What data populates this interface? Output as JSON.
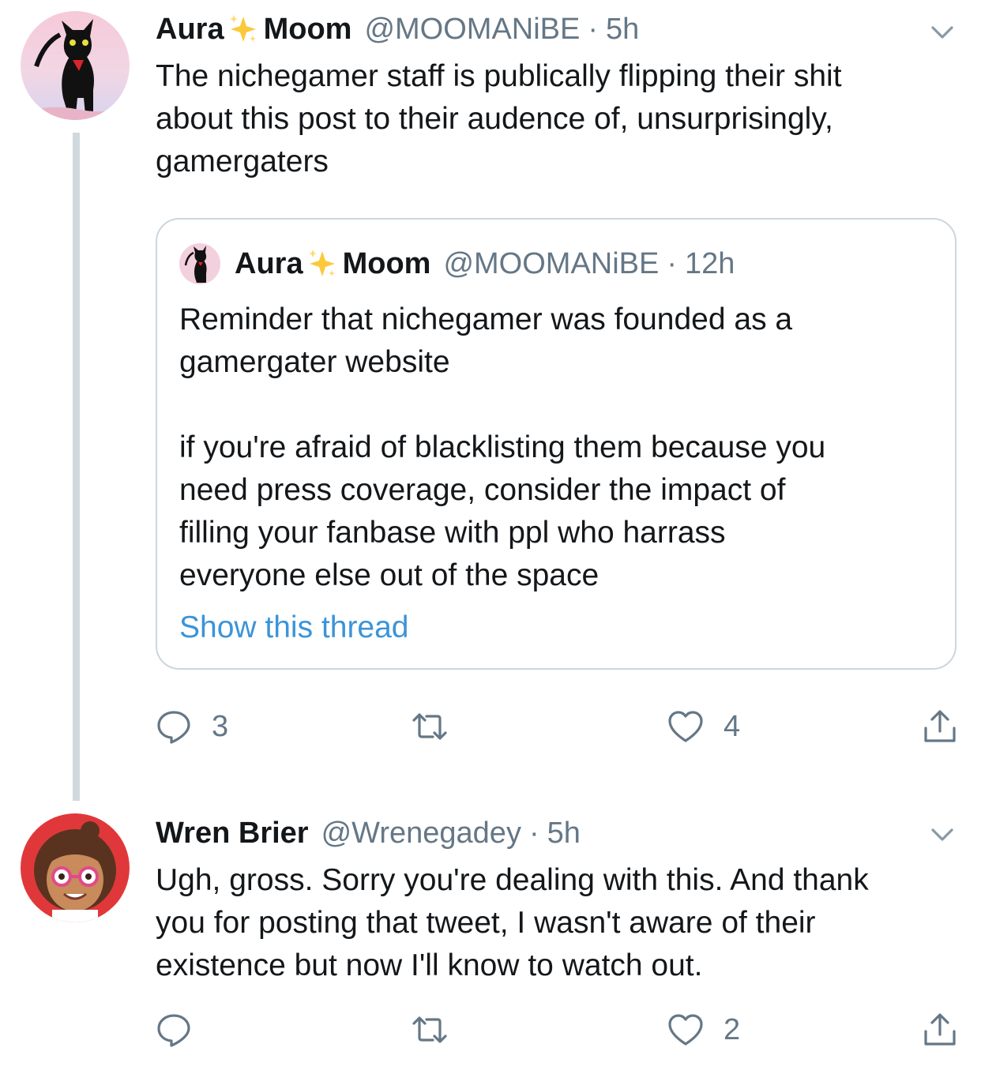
{
  "tweets": [
    {
      "author_name_part1": "Aura",
      "author_name_part2": "Moom",
      "sparkle_icon": "sparkles-emoji",
      "handle": "@MOOMANiBE",
      "separator": "·",
      "time": "5h",
      "text_lines": [
        "The nichegamer staff is publically flipping their shit",
        "about this post to their audence of, unsurprisingly,",
        "gamergaters"
      ],
      "quote": {
        "author_name_part1": "Aura",
        "author_name_part2": "Moom",
        "handle": "@MOOMANiBE",
        "separator": "·",
        "time": "12h",
        "paragraph1_lines": [
          "Reminder that nichegamer was founded as a",
          "gamergater website"
        ],
        "paragraph2_lines": [
          "if you're afraid of blacklisting them because you",
          "need press coverage, consider the impact of",
          "filling your fanbase with ppl who harrass",
          "everyone else out of the space"
        ],
        "show_thread": "Show this thread"
      },
      "actions": {
        "replies": "3",
        "retweets": "",
        "likes": "4"
      }
    },
    {
      "author_name": "Wren Brier",
      "handle": "@Wrenegadey",
      "separator": "·",
      "time": "5h",
      "text_lines": [
        "Ugh, gross. Sorry you're dealing with this. And thank",
        "you for posting that tweet, I wasn't aware of their",
        "existence but now I'll know to watch out."
      ],
      "actions": {
        "replies": "",
        "retweets": "",
        "likes": "2"
      }
    }
  ],
  "colors": {
    "text": "#14171a",
    "secondary": "#657786",
    "link": "#3b94d9",
    "border": "#ccd6dd",
    "thread_line": "#cfd9de"
  },
  "icons": [
    "reply-icon",
    "retweet-icon",
    "like-icon",
    "share-icon",
    "chevron-down-icon"
  ]
}
